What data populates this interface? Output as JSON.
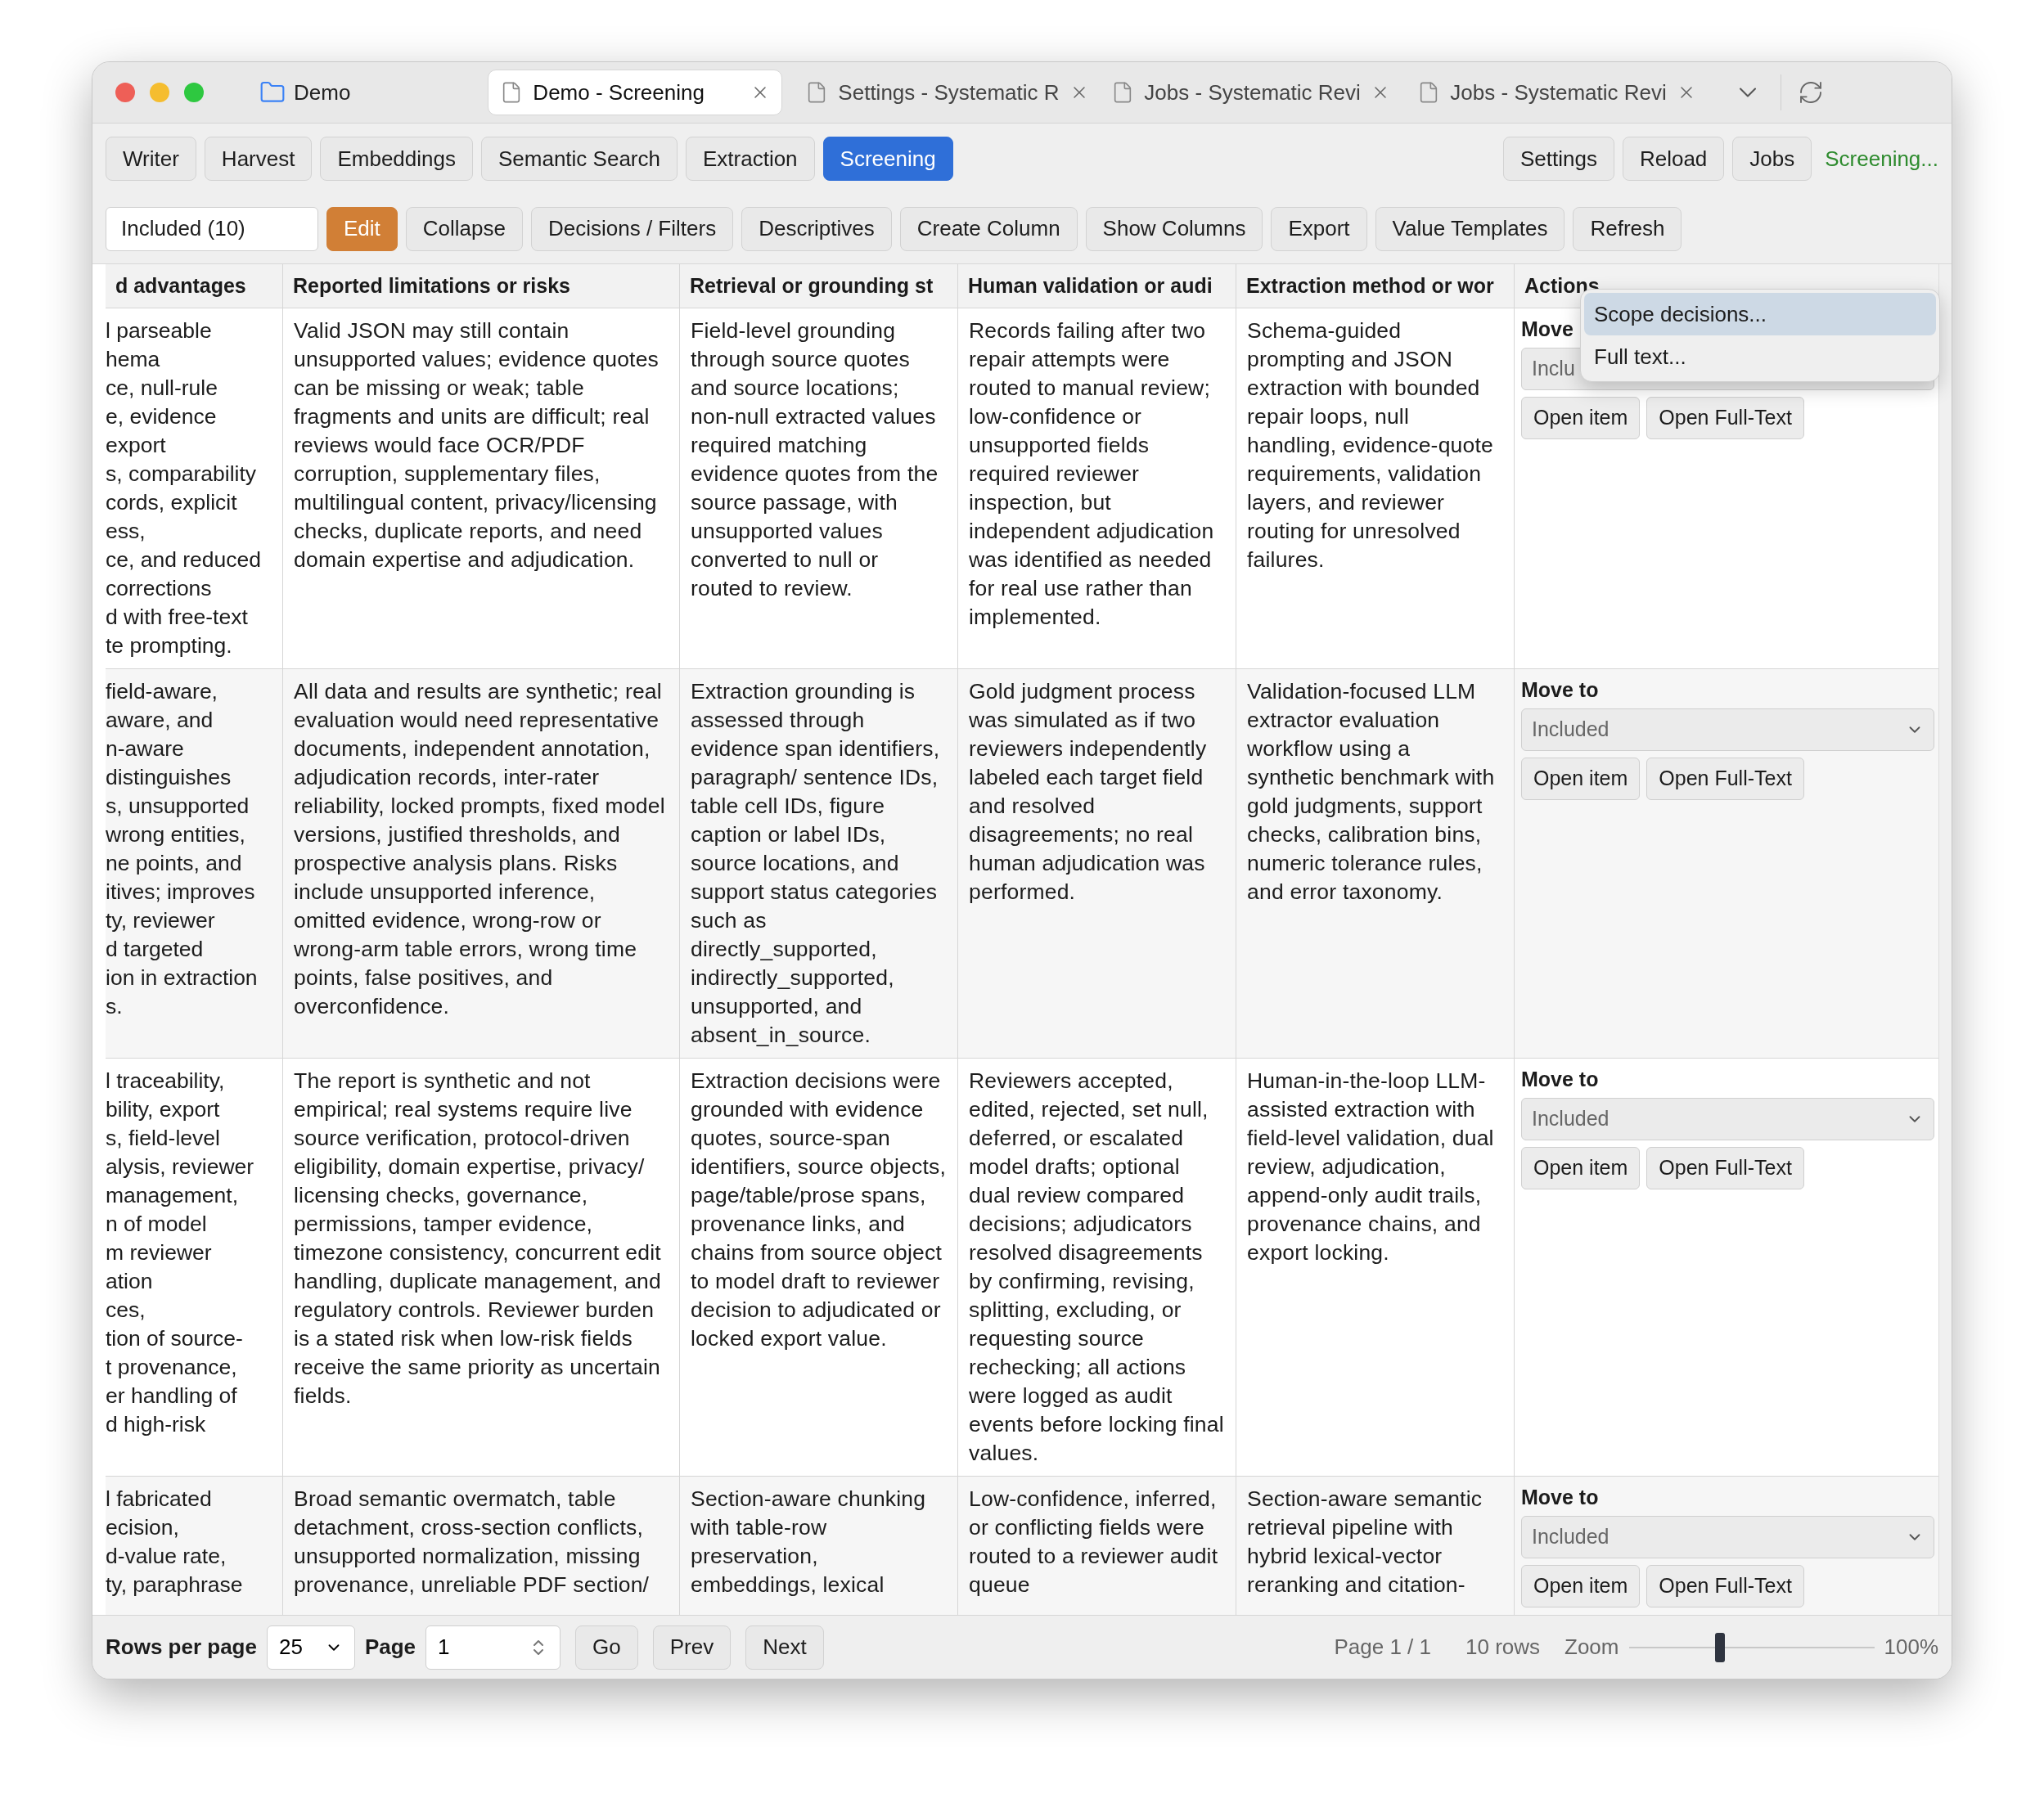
{
  "window": {
    "folder": "Demo",
    "tabs": [
      {
        "label": "Demo - Screening",
        "selected": true
      },
      {
        "label": "Settings - Systematic R",
        "selected": false
      },
      {
        "label": "Jobs - Systematic Revi",
        "selected": false
      },
      {
        "label": "Jobs - Systematic Revi",
        "selected": false
      }
    ]
  },
  "nav": {
    "left": [
      {
        "label": "Writer",
        "selected": false
      },
      {
        "label": "Harvest",
        "selected": false
      },
      {
        "label": "Embeddings",
        "selected": false
      },
      {
        "label": "Semantic Search",
        "selected": false
      },
      {
        "label": "Extraction",
        "selected": false
      },
      {
        "label": "Screening",
        "selected": true
      }
    ],
    "right": [
      "Settings",
      "Reload",
      "Jobs"
    ],
    "status": "Screening..."
  },
  "toolbar": {
    "filter": "Included (10)",
    "buttons": [
      {
        "label": "Edit",
        "selected": true
      },
      {
        "label": "Collapse",
        "selected": false
      },
      {
        "label": "Decisions / Filters",
        "selected": false
      },
      {
        "label": "Descriptives",
        "selected": false
      },
      {
        "label": "Create Column",
        "selected": false
      },
      {
        "label": "Show Columns",
        "selected": false
      },
      {
        "label": "Export",
        "selected": false
      },
      {
        "label": "Value Templates",
        "selected": false
      },
      {
        "label": "Refresh",
        "selected": false
      }
    ]
  },
  "table": {
    "columns": [
      "d advantages",
      "Reported limitations or risks",
      "Retrieval or grounding st",
      "Human validation or audi",
      "Extraction method or wor",
      "Actions"
    ],
    "rows": [
      {
        "cells": [
          "l parseable\nhema\nce, null-rule\ne, evidence\nexport\ns, comparability\ncords, explicit\ness,\nce, and reduced\ncorrections\nd with free-text\nte prompting.",
          "Valid JSON may still contain unsupported values; evidence quotes can be missing or weak; table fragments and units are difficult; real reviews would face OCR/PDF corruption, supplementary files, multilingual content, privacy/licensing checks, duplicate reports, and need domain expertise and adjudication.",
          "Field-level grounding through source quotes and source locations; non-null extracted values required matching evidence quotes from the source passage, with unsupported values converted to null or routed to review.",
          "Records failing after two repair attempts were routed to manual review; low-confidence or unsupported fields required reviewer inspection, but independent adjudication was identified as needed for real use rather than implemented.",
          "Schema-guided prompting and JSON extraction with bounded repair loops, null handling, evidence-quote requirements, validation layers, and reviewer routing for unresolved failures."
        ],
        "actions": {
          "label": "Move",
          "select": "Inclu",
          "buttons": [
            "Open item",
            "Open Full-Text"
          ]
        }
      },
      {
        "cells": [
          "field-aware,\naware, and\nn-aware\ndistinguishes\ns, unsupported\nwrong entities,\nne points, and\nitives; improves\nty, reviewer\nd targeted\nion in extraction\ns.",
          "All data and results are synthetic; real evaluation would need representative documents, independent annotation, adjudication records, inter-rater reliability, locked prompts, fixed model versions, justified thresholds, and prospective analysis plans. Risks include unsupported inference, omitted evidence, wrong-row or wrong-arm table errors, wrong time points, false positives, and overconfidence.",
          "Extraction grounding is assessed through evidence span identifiers, paragraph/ sentence IDs, table cell IDs, figure caption or label IDs, source locations, and support status categories such as directly_supported, indirectly_supported, unsupported, and absent_in_source.",
          "Gold judgment process was simulated as if two reviewers independently labeled each target field and resolved disagreements; no real human adjudication was performed.",
          "Validation-focused LLM extractor evaluation workflow using a synthetic benchmark with gold judgments, support checks, calibration bins, numeric tolerance rules, and error taxonomy."
        ],
        "actions": {
          "label": "Move to",
          "select": "Included",
          "buttons": [
            "Open item",
            "Open Full-Text"
          ]
        }
      },
      {
        "cells": [
          "l traceability,\nbility, export\ns, field-level\nalysis, reviewer\nmanagement,\nn of model\nm reviewer\nation\nces,\ntion of source-\nt provenance,\ner handling of\nd high-risk",
          "The report is synthetic and not empirical; real systems require live source verification, protocol-driven eligibility, domain expertise, privacy/ licensing checks, governance, permissions, tamper evidence, timezone consistency, concurrent edit handling, duplicate management, and regulatory controls. Reviewer burden is a stated risk when low-risk fields receive the same priority as uncertain fields.",
          "Extraction decisions were grounded with evidence quotes, source-span identifiers, source objects, page/table/prose spans, provenance links, and chains from source object to model draft to reviewer decision to adjudicated or locked export value.",
          "Reviewers accepted, edited, rejected, set null, deferred, or escalated model drafts; optional dual review compared decisions; adjudicators resolved disagreements by confirming, revising, splitting, excluding, or requesting source rechecking; all actions were logged as audit events before locking final values.",
          "Human-in-the-loop LLM-assisted extraction with field-level validation, dual review, adjudication, append-only audit trails, provenance chains, and export locking."
        ],
        "actions": {
          "label": "Move to",
          "select": "Included",
          "buttons": [
            "Open item",
            "Open Full-Text"
          ]
        }
      },
      {
        "cells": [
          "l fabricated\necision,\nd-value rate,\nty, paraphrase",
          "Broad semantic overmatch, table detachment, cross-section conflicts, unsupported normalization, missing provenance, unreliable PDF section/",
          "Section-aware chunking with table-row preservation, embeddings, lexical",
          "Low-confidence, inferred, or conflicting fields were routed to a reviewer audit queue",
          "Section-aware semantic retrieval pipeline with hybrid lexical-vector reranking and citation-"
        ],
        "actions": {
          "label": "Move to",
          "select": "Included",
          "buttons": [
            "Open item",
            "Open Full-Text"
          ]
        }
      }
    ]
  },
  "context_menu": {
    "items": [
      {
        "label": "Scope decisions...",
        "selected": true
      },
      {
        "label": "Full text...",
        "selected": false
      }
    ]
  },
  "footer": {
    "rows_label": "Rows per page",
    "rows_value": "25",
    "page_label": "Page",
    "page_value": "1",
    "buttons": [
      "Go",
      "Prev",
      "Next"
    ],
    "page_info": "Page 1 / 1",
    "row_count": "10 rows",
    "zoom_label": "Zoom",
    "zoom": {
      "level": 0.37
    },
    "zoom_value": "100%"
  }
}
